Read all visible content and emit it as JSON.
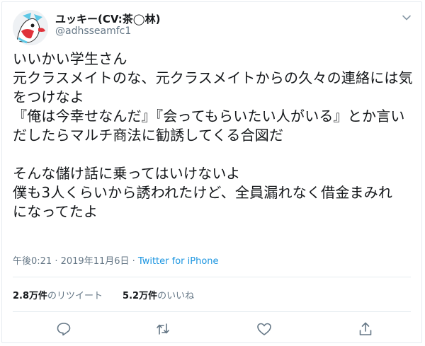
{
  "user": {
    "display_name": "ユッキー(CV:茶◯林)",
    "handle": "@adhsseamfc1"
  },
  "tweet": {
    "lines": [
      "いいかい学生さん",
      "元クラスメイトのな、元クラスメイトからの久々の連絡には気",
      "をつけなよ",
      "『俺は今幸せなんだ』『会ってもらいたい人がいる』とか言い",
      "だしたらマルチ商法に勧誘してくる合図だ",
      "そんな儲け話に乗ってはいけないよ",
      "僕も3人くらいから誘われたけど、全員漏れなく借金まみれ",
      "になってたよ"
    ]
  },
  "meta": {
    "time": "午後0:21",
    "separator": " · ",
    "date": "2019年11月6日",
    "source": "Twitter for iPhone"
  },
  "stats": {
    "retweets_count": "2.8万件",
    "retweets_label": "のリツイート",
    "likes_count": "5.2万件",
    "likes_label": "のいいね"
  },
  "colors": {
    "text": "#14171a",
    "secondary": "#657786",
    "link": "#1b95e0",
    "border": "#e6ecf0"
  },
  "icons": [
    "chevron-down-icon",
    "reply-icon",
    "retweet-icon",
    "like-icon",
    "share-icon"
  ]
}
